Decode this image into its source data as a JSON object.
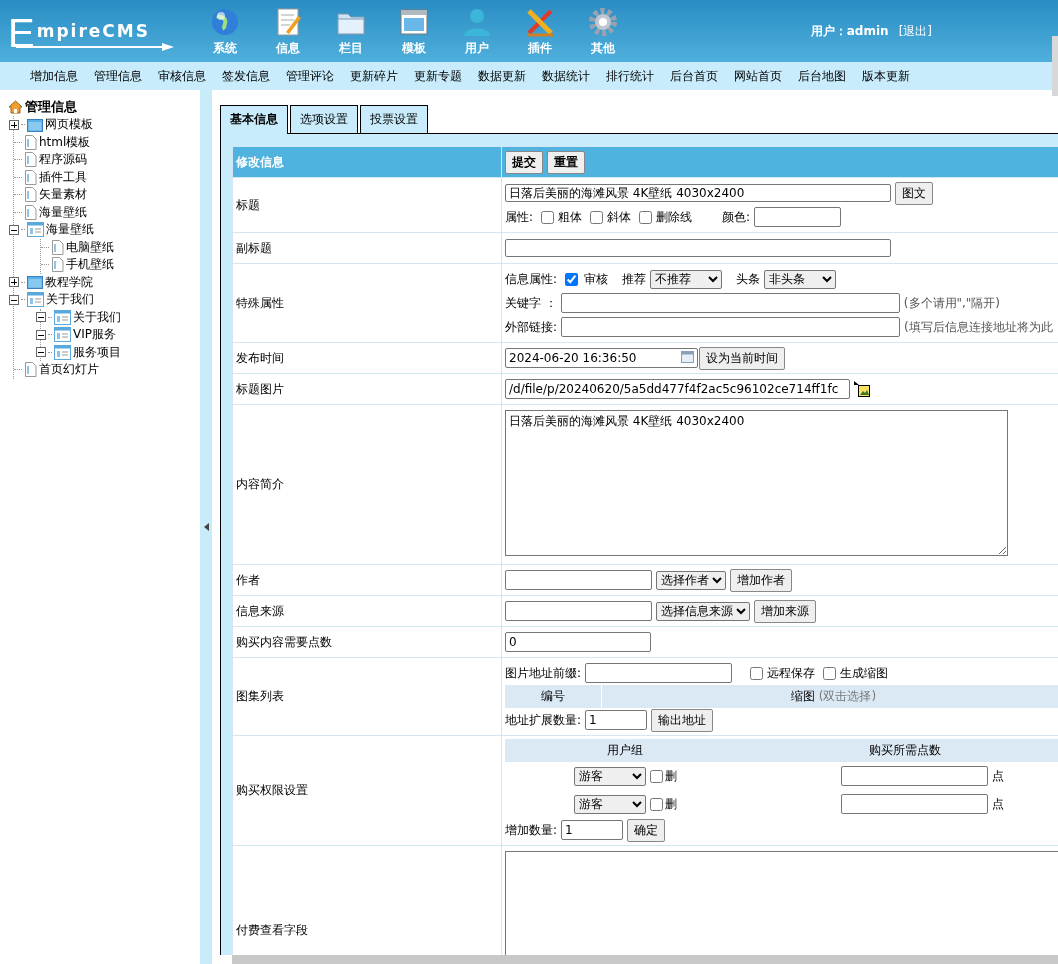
{
  "logo": {
    "initial": "E",
    "rest": "mpireCMS"
  },
  "nav": [
    {
      "label": "系统"
    },
    {
      "label": "信息"
    },
    {
      "label": "栏目"
    },
    {
      "label": "模板"
    },
    {
      "label": "用户"
    },
    {
      "label": "插件"
    },
    {
      "label": "其他"
    }
  ],
  "user": {
    "label": "用户：",
    "name": "admin",
    "logout": "[退出]"
  },
  "submenu": [
    "增加信息",
    "管理信息",
    "审核信息",
    "签发信息",
    "管理评论",
    "更新碎片",
    "更新专题",
    "数据更新",
    "数据统计",
    "排行统计",
    "后台首页",
    "网站首页",
    "后台地图",
    "版本更新"
  ],
  "sidebar": {
    "title": "管理信息",
    "items": [
      {
        "label": "网页模板",
        "kind": "folder",
        "expanded": false
      },
      {
        "label": "html模板",
        "kind": "page"
      },
      {
        "label": "程序源码",
        "kind": "page"
      },
      {
        "label": "插件工具",
        "kind": "page"
      },
      {
        "label": "矢量素材",
        "kind": "page"
      },
      {
        "label": "海量壁纸",
        "kind": "page"
      },
      {
        "label": "海量壁纸",
        "kind": "list",
        "expanded": true,
        "children": [
          {
            "label": "电脑壁纸",
            "kind": "page"
          },
          {
            "label": "手机壁纸",
            "kind": "page"
          }
        ]
      },
      {
        "label": "教程学院",
        "kind": "folder",
        "expanded": false
      },
      {
        "label": "关于我们",
        "kind": "list",
        "expanded": true,
        "children": [
          {
            "label": "关于我们",
            "kind": "list",
            "expanded": true
          },
          {
            "label": "VIP服务",
            "kind": "list",
            "expanded": true
          },
          {
            "label": "服务项目",
            "kind": "list",
            "expanded": true
          }
        ]
      },
      {
        "label": "首页幻灯片",
        "kind": "page"
      }
    ]
  },
  "tabs": [
    {
      "label": "基本信息",
      "selected": true
    },
    {
      "label": "选项设置",
      "selected": false
    },
    {
      "label": "投票设置",
      "selected": false
    }
  ],
  "form": {
    "title": "修改信息",
    "buttons": [
      "提交",
      "重置"
    ],
    "rows": [
      {
        "kind": "title",
        "label": "标题",
        "value": "日落后美丽的海滩风景 4K壁纸 4030x2400",
        "button": "图文",
        "attr_label": "属性:",
        "options": [
          {
            "label": "粗体",
            "checked": false
          },
          {
            "label": "斜体",
            "checked": false
          },
          {
            "label": "删除线",
            "checked": false
          }
        ],
        "color_label": "颜色:"
      },
      {
        "kind": "text",
        "label": "副标题"
      },
      {
        "kind": "special",
        "label": "特殊属性",
        "info_label": "信息属性:",
        "review": {
          "label": "审核",
          "checked": true
        },
        "recommend_label": "推荐",
        "recommend": "不推荐",
        "headline_label": "头条",
        "headline": "非头条",
        "keyword_label": "关键字 ：",
        "keyword_hint": "(多个请用\",\"隔开)",
        "link_label": "外部链接:",
        "link_hint": "(填写后信息连接地址将为此"
      },
      {
        "kind": "datetime",
        "label": "发布时间",
        "value": "2024-06-20 16:36:50",
        "button": "设为当前时间"
      },
      {
        "kind": "image",
        "label": "标题图片",
        "value": "/d/file/p/20240620/5a5dd477f4f2ac5c96102ce714ff1fc"
      },
      {
        "kind": "textarea",
        "label": "内容简介",
        "value": "日落后美丽的海滩风景 4K壁纸 4030x2400"
      },
      {
        "kind": "select_add",
        "label": "作者",
        "select": "选择作者",
        "button": "增加作者"
      },
      {
        "kind": "select_add",
        "label": "信息来源",
        "select": "选择信息来源",
        "button": "增加来源"
      },
      {
        "kind": "number",
        "label": "购买内容需要点数",
        "value": "0"
      },
      {
        "kind": "gallery",
        "label": "图集列表",
        "prefix_label": "图片地址前缀:",
        "options": [
          {
            "label": "远程保存",
            "checked": false
          },
          {
            "label": "生成缩图",
            "checked": false
          }
        ],
        "number_col": "编号",
        "thumb_col": "缩图",
        "thumb_hint": "(双击选择)",
        "count_label": "地址扩展数量:",
        "count": "1",
        "button": "输出地址"
      },
      {
        "kind": "permissions",
        "label": "购买权限设置",
        "columns": [
          "用户组",
          "购买所需点数"
        ],
        "entries": [
          {
            "group": "游客",
            "delete_label": "删",
            "checked": false,
            "unit": "点"
          },
          {
            "group": "游客",
            "delete_label": "删",
            "checked": false,
            "unit": "点"
          }
        ],
        "count_label": "增加数量:",
        "count": "1",
        "button": "确定"
      },
      {
        "kind": "large_textarea",
        "label": "付费查看字段"
      }
    ]
  }
}
